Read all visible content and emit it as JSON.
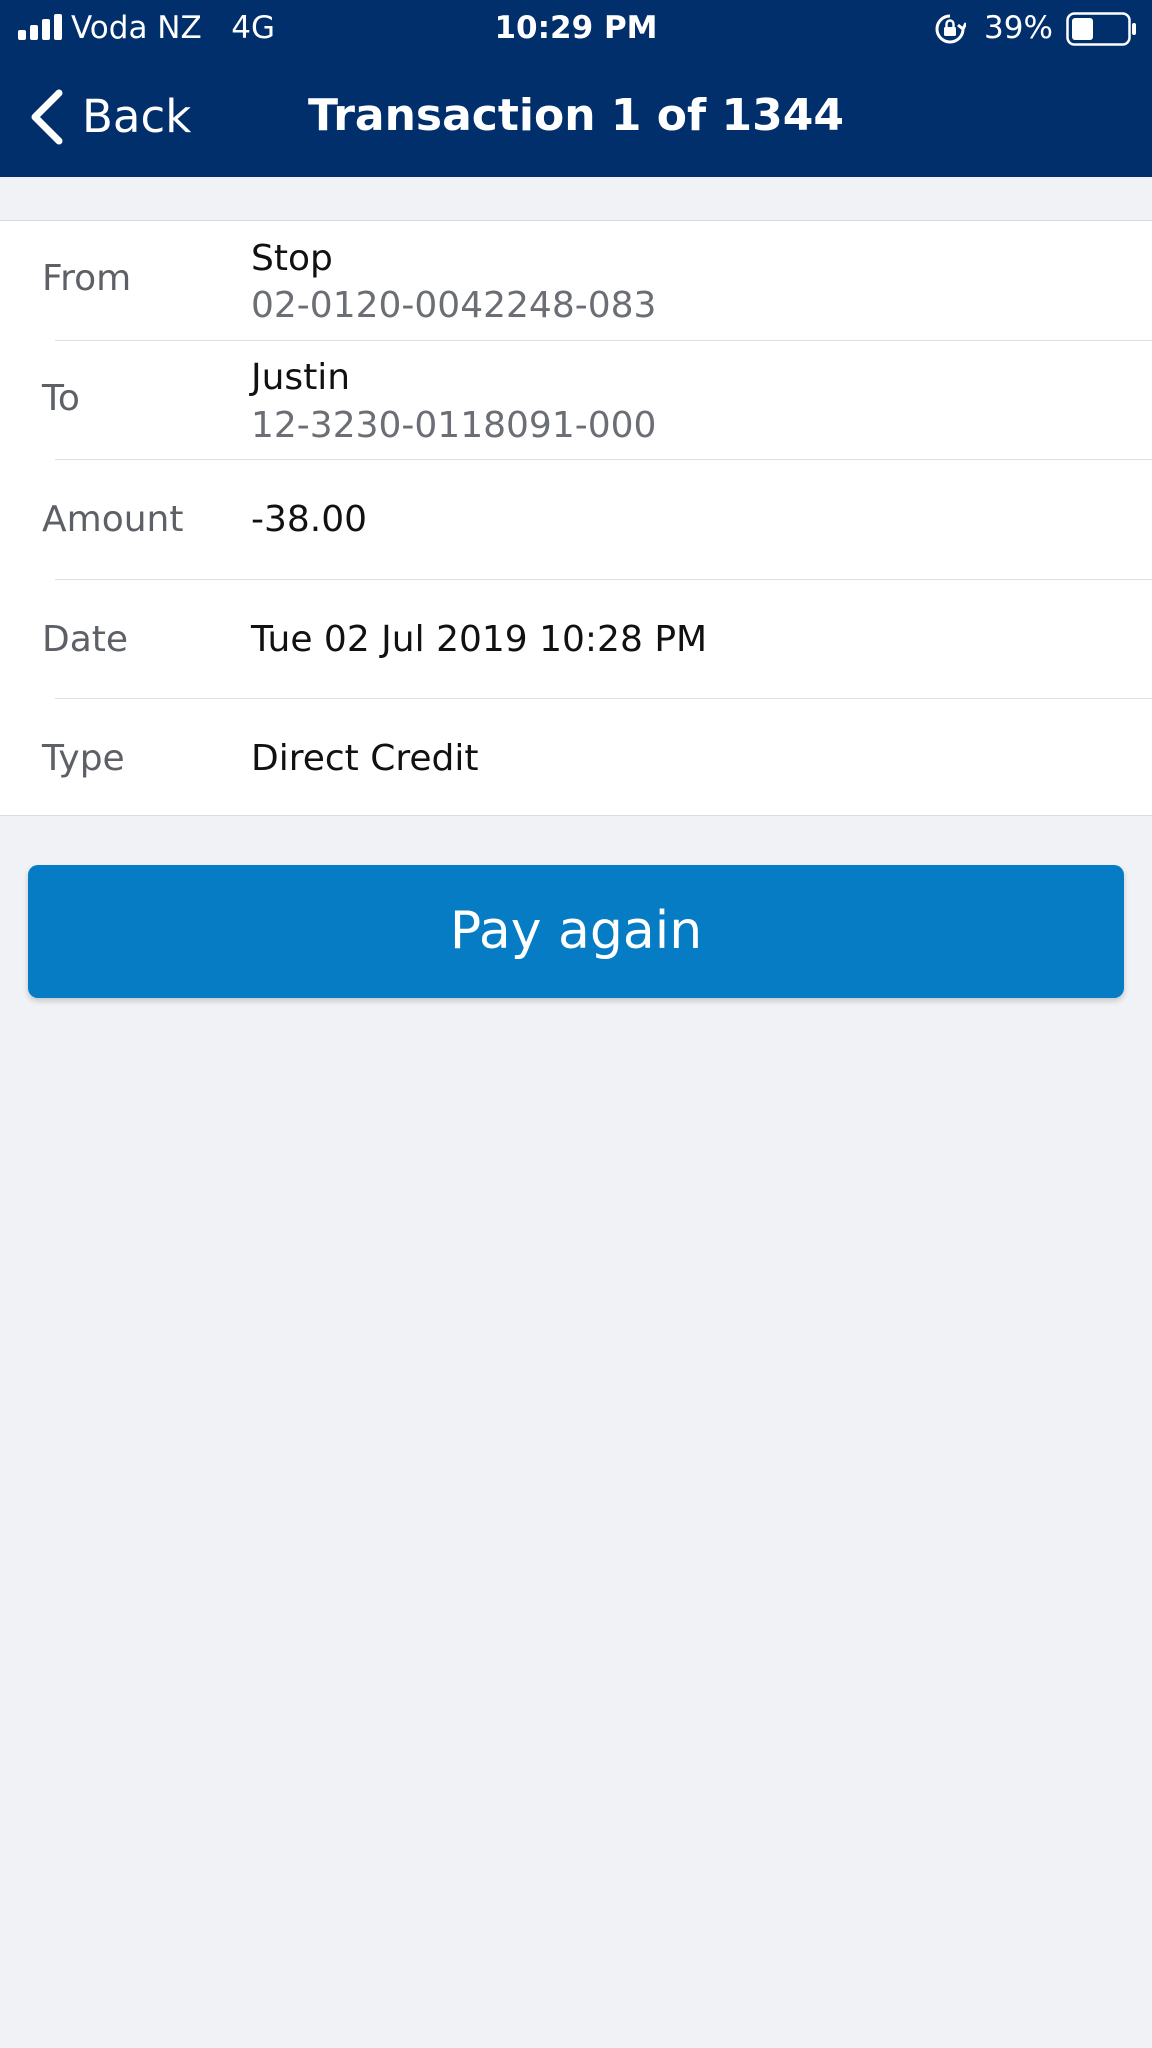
{
  "status_bar": {
    "carrier": "Voda NZ   4G",
    "time": "10:29 PM",
    "battery_percent": "39%",
    "battery_level": 0.39,
    "icons": [
      "signal-bars-icon",
      "rotation-lock-icon",
      "battery-icon"
    ]
  },
  "nav": {
    "back_label": "Back",
    "title": "Transaction 1 of 1344"
  },
  "transaction": {
    "from_label": "From",
    "from_name": "Stop",
    "from_account": "02-0120-0042248-083",
    "to_label": "To",
    "to_name": "Justin",
    "to_account": "12-3230-0118091-000",
    "amount_label": "Amount",
    "amount": "-38.00",
    "date_label": "Date",
    "date": "Tue 02 Jul 2019 10:28 PM",
    "type_label": "Type",
    "type": "Direct Credit"
  },
  "actions": {
    "pay_again_label": "Pay again"
  },
  "colors": {
    "header": "#002f6c",
    "button": "#057cc4",
    "background": "#f0f2f6"
  }
}
